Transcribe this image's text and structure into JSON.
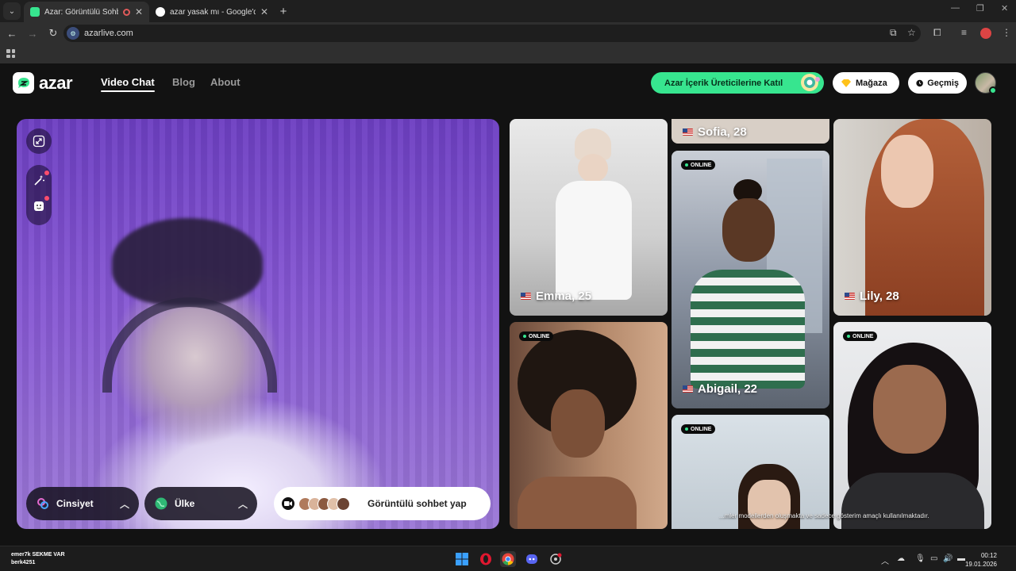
{
  "browser": {
    "tabs": [
      {
        "title": "Azar: Görüntülü Sohbet & Y",
        "active": true
      },
      {
        "title": "azar yasak mı - Google'da Ara",
        "active": false
      }
    ],
    "url": "azarlive.com"
  },
  "site": {
    "logo_text": "azar",
    "nav": [
      "Video Chat",
      "Blog",
      "About"
    ],
    "creator_button": "Azar İçerik Üreticilerine Katıl",
    "shop_button": "Mağaza",
    "history_button": "Geçmiş"
  },
  "video_panel": {
    "gender_filter": "Cinsiyet",
    "country_filter": "Ülke",
    "start_button": "Görüntülü sohbet yap"
  },
  "profiles": [
    {
      "name": "Sofia, 28",
      "online": false
    },
    {
      "name": "Emma, 25",
      "online": false
    },
    {
      "name": "Lily, 28",
      "online": false
    },
    {
      "name": "Abigail, 22",
      "online": true
    },
    {
      "name": "",
      "online": true
    },
    {
      "name": "",
      "online": true
    },
    {
      "name": "",
      "online": true
    }
  ],
  "online_label": "ONLINE",
  "disclaimer": "...mler modellerden oluşmakta ve sadece gösterim amaçlı kullanılmaktadır.",
  "taskbar": {
    "user_line1": "emer7k SEKME VAR",
    "user_line2": "berk4251",
    "time": "00:12",
    "date": "19.01.2026"
  },
  "colors": {
    "brand_green": "#37e58f",
    "page_bg": "#121212"
  }
}
